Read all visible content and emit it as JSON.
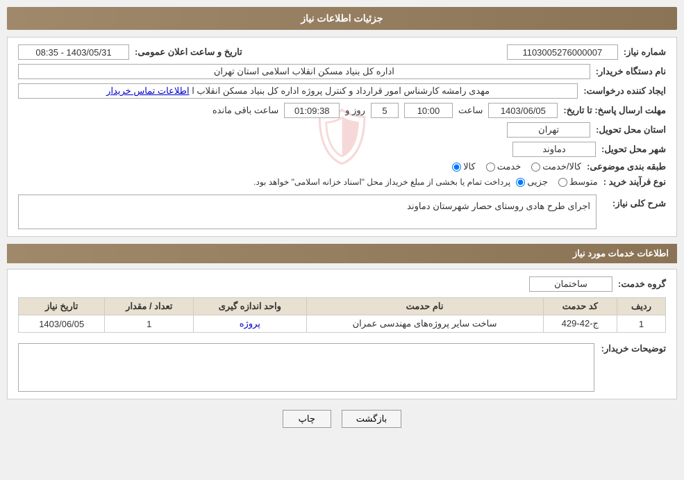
{
  "page": {
    "title": "جزئیات اطلاعات نیاز",
    "sections": {
      "need_info": "جزئیات اطلاعات نیاز",
      "service_info": "اطلاعات خدمات مورد نیاز"
    }
  },
  "fields": {
    "need_number_label": "شماره نیاز:",
    "need_number_value": "1103005276000007",
    "buyer_label": "نام دستگاه خریدار:",
    "buyer_value": "اداره کل بنیاد مسکن انقلاب اسلامی استان تهران",
    "creator_label": "ایجاد کننده درخواست:",
    "creator_value": "مهدی رامشه کارشناس امور قرارداد و کنترل پروژه اداره کل بنیاد مسکن انقلاب ا",
    "creator_link": "اطلاعات تماس خریدار",
    "date_label": "مهلت ارسال پاسخ: تا تاریخ:",
    "response_date": "1403/06/05",
    "response_time_label": "ساعت",
    "response_time": "10:00",
    "response_days_label": "روز و",
    "response_days": "5",
    "remaining_label": "ساعت باقی مانده",
    "remaining_time": "01:09:38",
    "province_label": "استان محل تحویل:",
    "province_value": "تهران",
    "city_label": "شهر محل تحویل:",
    "city_value": "دماوند",
    "category_label": "طبقه بندی موضوعی:",
    "category_options": [
      "کالا",
      "خدمت",
      "کالا/خدمت"
    ],
    "category_selected": "کالا",
    "process_label": "نوع فرآیند خرید :",
    "process_options": [
      "جزیی",
      "متوسط"
    ],
    "process_note": "پرداخت تمام یا بخشی از مبلغ خریداز محل \"اسناد خزانه اسلامی\" خواهد بود.",
    "announce_date_label": "تاریخ و ساعت اعلان عمومی:",
    "announce_date_value": "1403/05/31 - 08:35",
    "description_label": "شرح کلی نیاز:",
    "description_value": "اجرای طرح هادی روستای حصار شهرستان دماوند",
    "service_group_label": "گروه خدمت:",
    "service_group_value": "ساختمان",
    "table": {
      "headers": [
        "ردیف",
        "کد حدمت",
        "نام حدمت",
        "واحد اندازه گیری",
        "تعداد / مقدار",
        "تاریخ نیاز"
      ],
      "rows": [
        {
          "row": "1",
          "code": "ج-42-429",
          "name": "ساخت سایر پروژه‌های مهندسی عمران",
          "unit": "پروژه",
          "quantity": "1",
          "date": "1403/06/05"
        }
      ]
    },
    "buyer_notes_label": "توضیحات خریدار:",
    "buyer_notes_value": "",
    "buttons": {
      "print": "چاپ",
      "back": "بازگشت"
    }
  }
}
